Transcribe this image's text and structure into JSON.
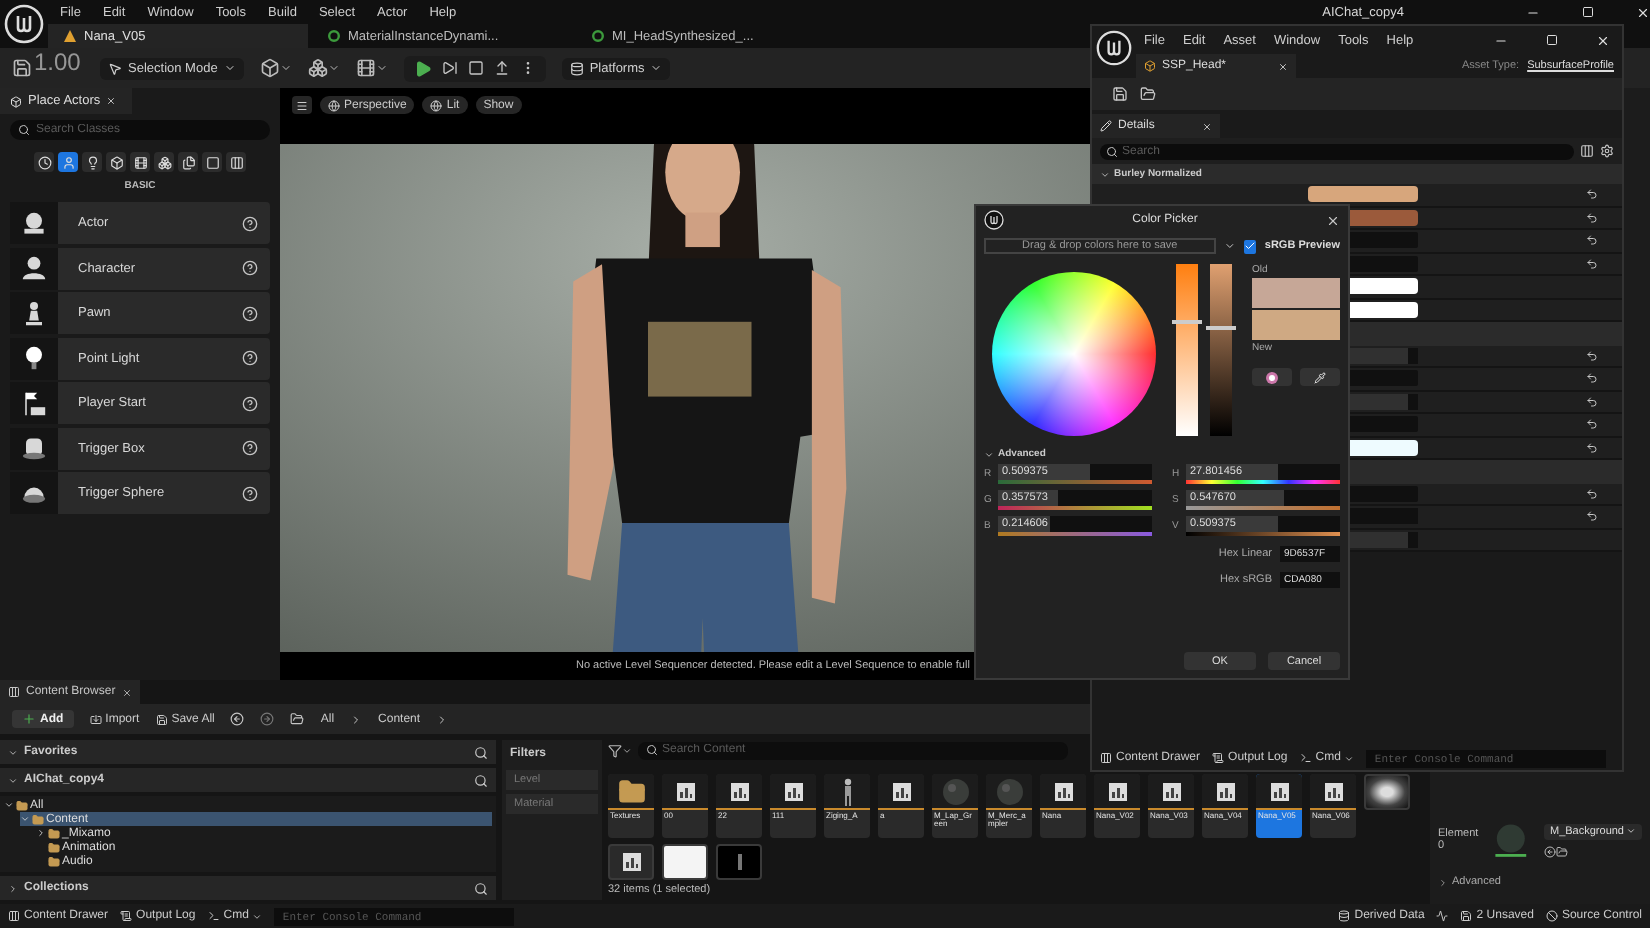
{
  "main": {
    "title": "AIChat_copy4",
    "menu": [
      "File",
      "Edit",
      "Window",
      "Tools",
      "Build",
      "Select",
      "Actor",
      "Help"
    ],
    "tabs": [
      {
        "label": "Nana_V05",
        "selected": true
      },
      {
        "label": "MaterialInstanceDynami...",
        "selected": false
      },
      {
        "label": "MI_HeadSynthesized_...",
        "selected": false
      }
    ],
    "overlay": "1.00",
    "mode": "Selection Mode",
    "platforms": "Platforms"
  },
  "place_actors": {
    "title": "Place Actors",
    "search": {
      "placeholder": "Search Classes"
    },
    "categories": [
      {
        "selected": false
      },
      {
        "selected": true
      },
      {
        "selected": false
      },
      {
        "selected": false
      },
      {
        "selected": false
      },
      {
        "selected": false
      },
      {
        "selected": false
      },
      {
        "selected": false
      },
      {
        "selected": false
      }
    ],
    "section": "BASIC",
    "items": [
      {
        "label": "Actor",
        "kind": "actor"
      },
      {
        "label": "Character",
        "kind": "character"
      },
      {
        "label": "Pawn",
        "kind": "pawn"
      },
      {
        "label": "Point Light",
        "kind": "light"
      },
      {
        "label": "Player Start",
        "kind": "start"
      },
      {
        "label": "Trigger Box",
        "kind": "box"
      },
      {
        "label": "Trigger Sphere",
        "kind": "sphere"
      }
    ]
  },
  "viewport": {
    "buttons": [
      "Perspective",
      "Lit",
      "Show"
    ],
    "message": "No active Level Sequencer detected. Please edit a Level Sequence to enable full"
  },
  "content_browser": {
    "tab": "Content Browser",
    "add": "Add",
    "toolbar": [
      "Import",
      "Save All"
    ],
    "path": [
      "All",
      "Content"
    ],
    "favorites": "Favorites",
    "project": "AIChat_copy4",
    "tree": [
      {
        "label": "All",
        "expanded": true,
        "selected": false,
        "children": [
          {
            "label": "Content",
            "expanded": true,
            "selected": true,
            "children": [
              {
                "label": "_Mixamo",
                "expanded": false,
                "selected": false
              },
              {
                "label": "Animation",
                "selected": false
              },
              {
                "label": "Audio",
                "selected": false
              }
            ]
          }
        ]
      }
    ],
    "collections": "Collections",
    "filters": {
      "title": "Filters",
      "items": [
        "Level",
        "Material"
      ]
    },
    "search": {
      "placeholder": "Search Content"
    },
    "assets": [
      {
        "kind": "folder",
        "label": "Textures",
        "selected": false
      },
      {
        "kind": "texture",
        "label": "00",
        "selected": false
      },
      {
        "kind": "texture",
        "label": "22",
        "selected": false
      },
      {
        "kind": "texture",
        "label": "111",
        "selected": false
      },
      {
        "kind": "character",
        "label": "Ziging_A",
        "selected": false
      },
      {
        "kind": "texture",
        "label": "a",
        "selected": false
      },
      {
        "kind": "sphere",
        "label": "M_Lap_Green",
        "selected": false
      },
      {
        "kind": "sphere",
        "label": "M_Merc_ampler",
        "selected": false
      },
      {
        "kind": "texture",
        "label": "Nana",
        "selected": false
      },
      {
        "kind": "texture",
        "label": "Nana_V02",
        "selected": false
      },
      {
        "kind": "texture",
        "label": "Nana_V03",
        "selected": false
      },
      {
        "kind": "texture",
        "label": "Nana_V04",
        "selected": false
      },
      {
        "kind": "texture",
        "label": "Nana_V05",
        "selected": true
      },
      {
        "kind": "texture",
        "label": "Nana_V06",
        "selected": false
      }
    ],
    "more_assets": [
      {
        "kind": "rock"
      },
      {
        "kind": "texture"
      },
      {
        "kind": "white"
      },
      {
        "kind": "dark"
      }
    ],
    "count": "32 items (1 selected)"
  },
  "main_details": {
    "element": "Element 0",
    "material": "M_Background",
    "advanced": "Advanced"
  },
  "status_bar": {
    "items": [
      "Content Drawer",
      "Output Log"
    ],
    "cmd": "Cmd",
    "console": {
      "placeholder": "Enter Console Command"
    },
    "right": [
      "Derived Data",
      "2 Unsaved",
      "Source Control"
    ]
  },
  "asset_editor": {
    "menu": [
      "File",
      "Edit",
      "Asset",
      "Window",
      "Tools",
      "Help"
    ],
    "tab": "SSP_Head*",
    "asset_type_label": "Asset Type:",
    "asset_type": "SubsurfaceProfile",
    "details_tab": "Details",
    "search": {
      "placeholder": "Search"
    },
    "section": "Burley Normalized",
    "rows": [
      {
        "kind": "swatch",
        "color": "#d7a67c",
        "reset": true
      },
      {
        "kind": "swatch",
        "color": "#9b5a3b",
        "reset": true
      },
      {
        "kind": "field",
        "reset": true
      },
      {
        "kind": "field",
        "reset": true
      },
      {
        "kind": "swatch",
        "color": "#ffffff",
        "reset": false
      },
      {
        "kind": "swatch",
        "color": "#ffffff",
        "reset": false
      },
      {
        "kind": "header"
      },
      {
        "kind": "bar",
        "level": 0.9,
        "reset": true
      },
      {
        "kind": "field",
        "reset": true
      },
      {
        "kind": "bar",
        "level": 0.9,
        "reset": true
      },
      {
        "kind": "field",
        "reset": true
      },
      {
        "kind": "swatch",
        "color": "#eefbff",
        "reset": true
      },
      {
        "kind": "header"
      },
      {
        "kind": "field",
        "reset": true
      },
      {
        "kind": "bar",
        "level": 0.25,
        "reset": true
      },
      {
        "kind": "bar",
        "level": 0.9,
        "reset": false
      }
    ],
    "status_bar": {
      "items": [
        "Content Drawer",
        "Output Log"
      ],
      "cmd": "Cmd",
      "console": {
        "placeholder": "Enter Console Command"
      }
    }
  },
  "color_picker": {
    "title": "Color Picker",
    "drop_hint": "Drag & drop colors here to save",
    "srgb": {
      "label": "sRGB Preview",
      "checked": true
    },
    "bars": [
      {
        "kind": "saturation",
        "level": 0.65
      },
      {
        "kind": "value",
        "level": 0.62
      }
    ],
    "previews": [
      {
        "label": "Old",
        "color": "#c6a797"
      },
      {
        "label": "New",
        "color": "#cfa983"
      }
    ],
    "advanced": "Advanced",
    "channels": [
      {
        "label": "R",
        "value": "0.509375",
        "level": 0.6,
        "kind": "red"
      },
      {
        "label": "H",
        "value": "27.801456",
        "level": 0.6,
        "kind": "hue"
      },
      {
        "label": "G",
        "value": "0.357573",
        "level": 0.39,
        "kind": "green"
      },
      {
        "label": "S",
        "value": "0.547670",
        "level": 0.64,
        "kind": "saturation"
      },
      {
        "label": "B",
        "value": "0.214606",
        "level": 0.34,
        "kind": "blue"
      },
      {
        "label": "V",
        "value": "0.509375",
        "level": 0.6,
        "kind": "value"
      }
    ],
    "hex": [
      {
        "label": "Hex Linear",
        "value": "9D6537F"
      },
      {
        "label": "Hex sRGB",
        "value": "CDA080"
      }
    ],
    "buttons": [
      "OK",
      "Cancel"
    ]
  }
}
